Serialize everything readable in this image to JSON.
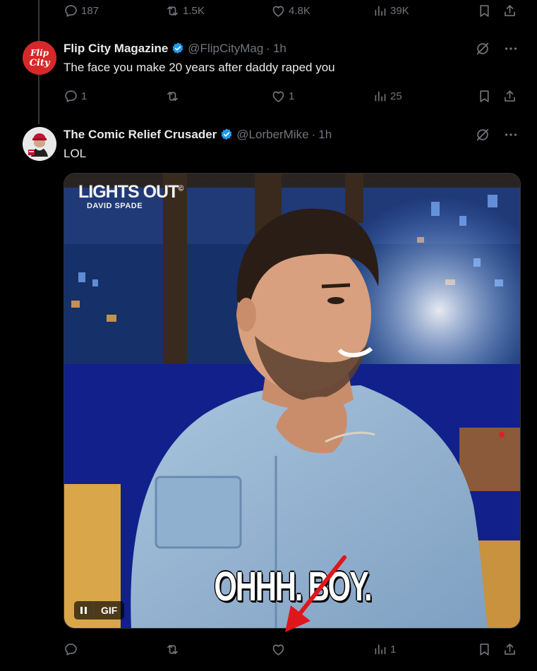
{
  "tweets": [
    {
      "actions": {
        "replies": "187",
        "reposts": "1.5K",
        "likes": "4.8K",
        "views": "39K"
      }
    },
    {
      "name": "Flip City Magazine",
      "handle": "@FlipCityMag",
      "separator": "·",
      "time": "1h",
      "avatar_text": "Flip City",
      "text": "The face you make 20 years after daddy raped you",
      "actions": {
        "replies": "1",
        "reposts": "",
        "likes": "1",
        "views": "25"
      }
    },
    {
      "name": "The Comic Relief Crusader",
      "handle": "@LorberMike",
      "separator": "·",
      "time": "1h",
      "text": "LOL",
      "media": {
        "brand_main": "LIGHTS OUT",
        "brand_circle": "©",
        "brand_sub": "DAVID SPADE",
        "caption": "OHHH. BOY.",
        "gif_label": "GIF"
      },
      "actions": {
        "replies": "",
        "reposts": "",
        "likes": "",
        "views": "1"
      }
    }
  ],
  "colors": {
    "background": "#000000",
    "text": "#e7e9ea",
    "muted": "#71767b",
    "verified": "#1d9bf0",
    "annotation_arrow": "#e0161b"
  },
  "icons": [
    "reply-icon",
    "repost-icon",
    "like-icon",
    "views-icon",
    "bookmark-icon",
    "share-icon",
    "grok-icon",
    "more-icon",
    "verified-icon",
    "pause-icon"
  ]
}
